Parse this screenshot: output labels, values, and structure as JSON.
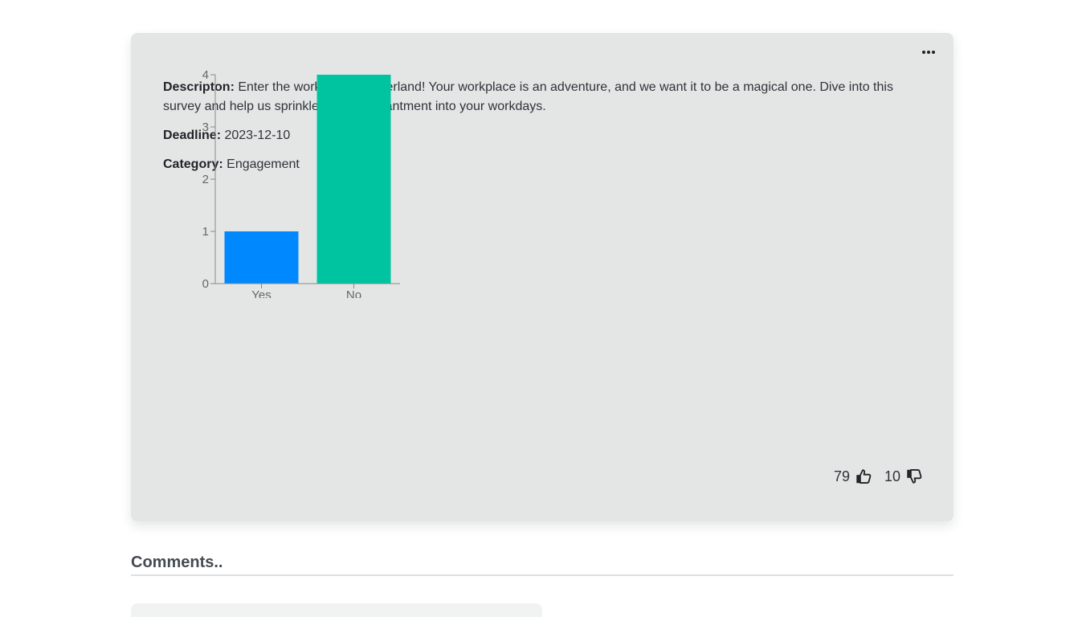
{
  "survey": {
    "description_label": "Descripton:",
    "description_text": "Enter the workplace wonderland! Your workplace is an adventure, and we want it to be a magical one. Dive into this survey and help us sprinkle some enchantment into your workdays.",
    "deadline_label": "Deadline:",
    "deadline_value": "2023-12-10",
    "category_label": "Category:",
    "category_value": "Engagement",
    "more_icon": "more-horizontal-icon",
    "likes": "79",
    "dislikes": "10",
    "like_icon": "thumbs-up-icon",
    "dislike_icon": "thumbs-down-icon"
  },
  "chart_data": {
    "type": "bar",
    "categories": [
      "Yes",
      "No"
    ],
    "values": [
      1,
      4
    ],
    "colors": [
      "#0088fe",
      "#00c49f"
    ],
    "ylim": [
      0,
      4
    ],
    "yticks": [
      0,
      1,
      2,
      3,
      4
    ],
    "title": "",
    "xlabel": "",
    "ylabel": ""
  },
  "comments": {
    "heading": "Comments.."
  }
}
